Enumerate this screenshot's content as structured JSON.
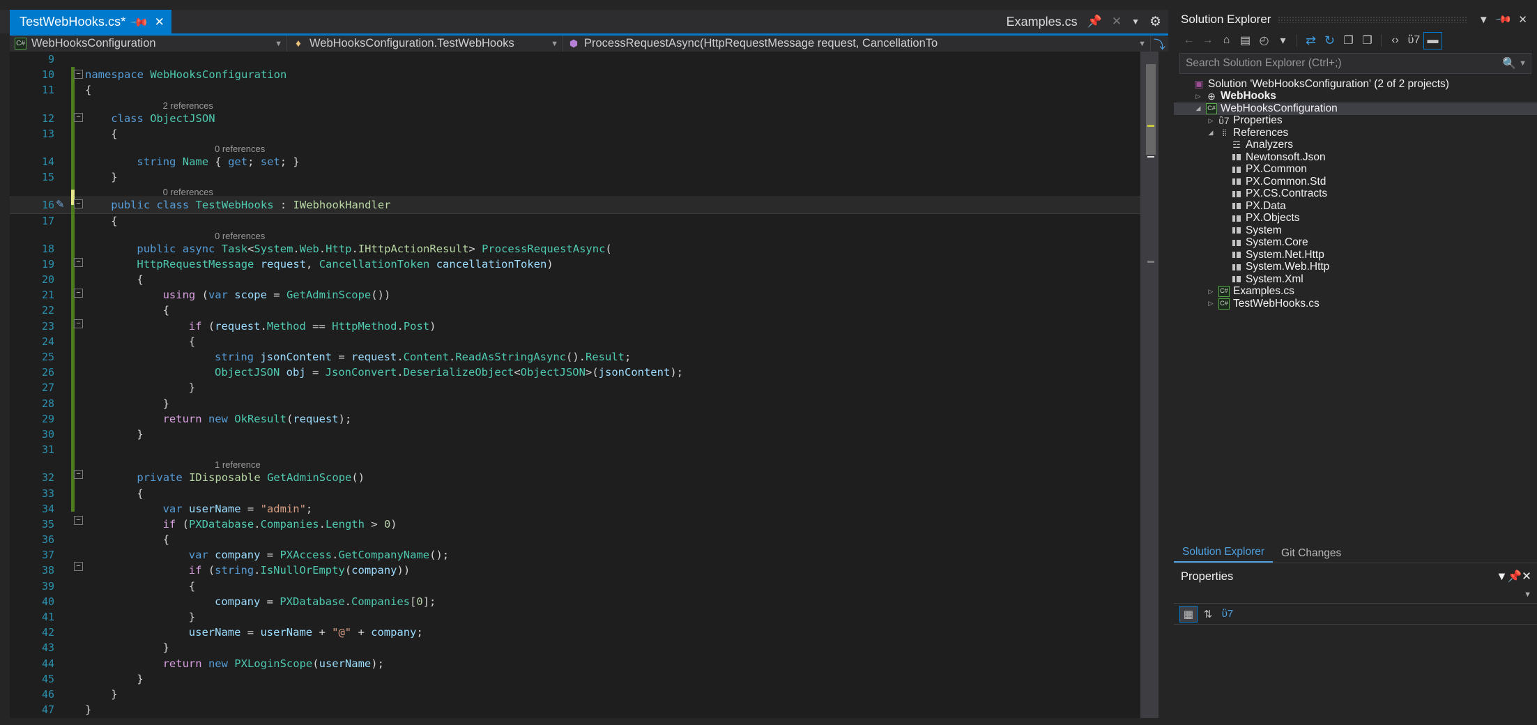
{
  "editor": {
    "tab": {
      "label": "TestWebHooks.cs*",
      "pin_icon": "pin-icon",
      "close_icon": "close-icon"
    },
    "tab_right": {
      "label": "Examples.cs",
      "pin_icon": "pin-icon",
      "close_icon": "close-icon",
      "caret_icon": "chevron-down-icon",
      "gear_icon": "gear-icon"
    },
    "navbar": {
      "project": "WebHooksConfiguration",
      "project_icon": "csharp-file-icon",
      "class": "WebHooksConfiguration.TestWebHooks",
      "class_icon": "class-icon",
      "member": "ProcessRequestAsync(HttpRequestMessage request, CancellationTo",
      "member_icon": "method-icon",
      "caret_icon": "chevron-down-icon",
      "split_icon": "split-view-icon"
    },
    "lines": [
      {
        "num": "9",
        "indent": 0,
        "text": ""
      },
      {
        "num": "10",
        "indent": 0,
        "text": "namespace WebHooksConfiguration"
      },
      {
        "num": "11",
        "indent": 0,
        "text": "{"
      },
      {
        "num": "",
        "ref": "2 references",
        "ref_indent": 3
      },
      {
        "num": "12",
        "indent": 1,
        "text": "class ObjectJSON"
      },
      {
        "num": "13",
        "indent": 1,
        "text": "{"
      },
      {
        "num": "",
        "ref": "0 references",
        "ref_indent": 5
      },
      {
        "num": "14",
        "indent": 2,
        "text": "string Name { get; set; }"
      },
      {
        "num": "15",
        "indent": 1,
        "text": "}"
      },
      {
        "num": "",
        "ref": "0 references",
        "ref_indent": 3
      },
      {
        "num": "16",
        "indent": 1,
        "text": "public class TestWebHooks : IWebhookHandler"
      },
      {
        "num": "17",
        "indent": 1,
        "text": "{"
      },
      {
        "num": "",
        "ref": "0 references",
        "ref_indent": 5
      },
      {
        "num": "18",
        "indent": 2,
        "text": "public async Task<System.Web.Http.IHttpActionResult> ProcessRequestAsync("
      },
      {
        "num": "19",
        "indent": 2,
        "text": "HttpRequestMessage request, CancellationToken cancellationToken)"
      },
      {
        "num": "20",
        "indent": 2,
        "text": "{"
      },
      {
        "num": "21",
        "indent": 3,
        "text": "using (var scope = GetAdminScope())"
      },
      {
        "num": "22",
        "indent": 3,
        "text": "{"
      },
      {
        "num": "23",
        "indent": 4,
        "text": "if (request.Method == HttpMethod.Post)"
      },
      {
        "num": "24",
        "indent": 4,
        "text": "{"
      },
      {
        "num": "25",
        "indent": 5,
        "text": "string jsonContent = request.Content.ReadAsStringAsync().Result;"
      },
      {
        "num": "26",
        "indent": 5,
        "text": "ObjectJSON obj = JsonConvert.DeserializeObject<ObjectJSON>(jsonContent);"
      },
      {
        "num": "27",
        "indent": 4,
        "text": "}"
      },
      {
        "num": "28",
        "indent": 3,
        "text": "}"
      },
      {
        "num": "29",
        "indent": 3,
        "text": "return new OkResult(request);"
      },
      {
        "num": "30",
        "indent": 2,
        "text": "}"
      },
      {
        "num": "31",
        "indent": 0,
        "text": ""
      },
      {
        "num": "",
        "ref": "1 reference",
        "ref_indent": 5
      },
      {
        "num": "32",
        "indent": 2,
        "text": "private IDisposable GetAdminScope()"
      },
      {
        "num": "33",
        "indent": 2,
        "text": "{"
      },
      {
        "num": "34",
        "indent": 3,
        "text": "var userName = \"admin\";"
      },
      {
        "num": "35",
        "indent": 3,
        "text": "if (PXDatabase.Companies.Length > 0)"
      },
      {
        "num": "36",
        "indent": 3,
        "text": "{"
      },
      {
        "num": "37",
        "indent": 4,
        "text": "var company = PXAccess.GetCompanyName();"
      },
      {
        "num": "38",
        "indent": 4,
        "text": "if (string.IsNullOrEmpty(company))"
      },
      {
        "num": "39",
        "indent": 4,
        "text": "{"
      },
      {
        "num": "40",
        "indent": 5,
        "text": "company = PXDatabase.Companies[0];"
      },
      {
        "num": "41",
        "indent": 4,
        "text": "}"
      },
      {
        "num": "42",
        "indent": 4,
        "text": "userName = userName + \"@\" + company;"
      },
      {
        "num": "43",
        "indent": 3,
        "text": "}"
      },
      {
        "num": "44",
        "indent": 3,
        "text": "return new PXLoginScope(userName);"
      },
      {
        "num": "45",
        "indent": 2,
        "text": "}"
      },
      {
        "num": "46",
        "indent": 1,
        "text": "}"
      },
      {
        "num": "47",
        "indent": 0,
        "text": "}"
      }
    ]
  },
  "solution_explorer": {
    "title": "Solution Explorer",
    "header_icons": {
      "dropdown": "chevron-down-icon",
      "pin": "pin-icon",
      "close": "close-icon"
    },
    "toolbar": [
      {
        "name": "back-icon",
        "glyph": "←",
        "state": "disabled"
      },
      {
        "name": "forward-icon",
        "glyph": "→",
        "state": "disabled"
      },
      {
        "name": "home-icon",
        "glyph": "⌂",
        "state": "normal"
      },
      {
        "name": "sync-with-active-document-icon",
        "glyph": "▤",
        "state": "normal"
      },
      {
        "name": "pending-changes-filter-icon",
        "glyph": "◴",
        "state": "normal"
      },
      {
        "name": "filter-caret-icon",
        "glyph": "▾",
        "state": "normal"
      },
      {
        "name": "refresh-icon",
        "glyph": "⇄",
        "state": "blue"
      },
      {
        "name": "reload-icon",
        "glyph": "↻",
        "state": "blue"
      },
      {
        "name": "collapse-all-icon",
        "glyph": "❐",
        "state": "normal"
      },
      {
        "name": "copy-icon",
        "glyph": "❐",
        "state": "normal"
      },
      {
        "name": "show-all-files-icon",
        "glyph": "‹›",
        "state": "normal"
      },
      {
        "name": "properties-wrench-icon",
        "glyph": "ὒ7",
        "state": "normal"
      },
      {
        "name": "preview-selected-items-icon",
        "glyph": "▬",
        "state": "boxed"
      }
    ],
    "search_placeholder": "Search Solution Explorer (Ctrl+;)",
    "search_value": "",
    "search_icon": "search-icon",
    "search_caret_icon": "chevron-down-icon",
    "tree": [
      {
        "label": "Solution 'WebHooksConfiguration' (2 of 2 projects)",
        "depth": 0,
        "twisty": "",
        "icon": "solution-icon",
        "bold": false,
        "selected": false
      },
      {
        "label": "WebHooks",
        "depth": 1,
        "twisty": "collapsed",
        "icon": "web-project-icon",
        "bold": true,
        "selected": false
      },
      {
        "label": "WebHooksConfiguration",
        "depth": 1,
        "twisty": "expanded",
        "icon": "csharp-project-icon",
        "bold": false,
        "selected": true
      },
      {
        "label": "Properties",
        "depth": 2,
        "twisty": "collapsed",
        "icon": "properties-icon",
        "bold": false,
        "selected": false
      },
      {
        "label": "References",
        "depth": 2,
        "twisty": "expanded",
        "icon": "references-icon",
        "bold": false,
        "selected": false
      },
      {
        "label": "Analyzers",
        "depth": 3,
        "twisty": "",
        "icon": "analyzers-icon",
        "bold": false,
        "selected": false
      },
      {
        "label": "Newtonsoft.Json",
        "depth": 3,
        "twisty": "",
        "icon": "assembly-icon",
        "bold": false,
        "selected": false
      },
      {
        "label": "PX.Common",
        "depth": 3,
        "twisty": "",
        "icon": "assembly-icon",
        "bold": false,
        "selected": false
      },
      {
        "label": "PX.Common.Std",
        "depth": 3,
        "twisty": "",
        "icon": "assembly-icon",
        "bold": false,
        "selected": false
      },
      {
        "label": "PX.CS.Contracts",
        "depth": 3,
        "twisty": "",
        "icon": "assembly-icon",
        "bold": false,
        "selected": false
      },
      {
        "label": "PX.Data",
        "depth": 3,
        "twisty": "",
        "icon": "assembly-icon",
        "bold": false,
        "selected": false
      },
      {
        "label": "PX.Objects",
        "depth": 3,
        "twisty": "",
        "icon": "assembly-icon",
        "bold": false,
        "selected": false
      },
      {
        "label": "System",
        "depth": 3,
        "twisty": "",
        "icon": "assembly-icon",
        "bold": false,
        "selected": false
      },
      {
        "label": "System.Core",
        "depth": 3,
        "twisty": "",
        "icon": "assembly-icon",
        "bold": false,
        "selected": false
      },
      {
        "label": "System.Net.Http",
        "depth": 3,
        "twisty": "",
        "icon": "assembly-icon",
        "bold": false,
        "selected": false
      },
      {
        "label": "System.Web.Http",
        "depth": 3,
        "twisty": "",
        "icon": "assembly-icon",
        "bold": false,
        "selected": false
      },
      {
        "label": "System.Xml",
        "depth": 3,
        "twisty": "",
        "icon": "assembly-icon",
        "bold": false,
        "selected": false
      },
      {
        "label": "Examples.cs",
        "depth": 2,
        "twisty": "collapsed",
        "icon": "csharp-file-icon",
        "bold": false,
        "selected": false
      },
      {
        "label": "TestWebHooks.cs",
        "depth": 2,
        "twisty": "collapsed",
        "icon": "csharp-file-icon",
        "bold": false,
        "selected": false
      }
    ],
    "bottom_tabs": [
      {
        "label": "Solution Explorer",
        "active": true
      },
      {
        "label": "Git Changes",
        "active": false
      }
    ]
  },
  "properties": {
    "title": "Properties",
    "header_icons": {
      "dropdown": "chevron-down-icon",
      "pin": "pin-icon",
      "close": "close-icon"
    },
    "sub_caret_icon": "chevron-down-icon",
    "toolbar": [
      {
        "name": "categorized-icon",
        "glyph": "▦",
        "state": "selected"
      },
      {
        "name": "alphabetical-icon",
        "glyph": "⇅",
        "state": "normal"
      },
      {
        "name": "property-pages-icon",
        "glyph": "ὒ7",
        "state": "blue"
      }
    ]
  },
  "colors": {
    "accent": "#007acc",
    "tab_active_bg": "#007acc",
    "editor_bg": "#1e1e1e",
    "chrome_bg": "#252526",
    "panel_selection": "#3f3f46",
    "line_number": "#2b91af",
    "keyword": "#569cd6",
    "control_keyword": "#d8a0df",
    "type": "#4ec9b0",
    "string": "#d69d85",
    "method": "#dcdcaa",
    "variable": "#9cdcfe",
    "interface": "#b8d7a3",
    "change_bar_saved": "#4d7d1f",
    "change_bar_unsaved": "#e6e68a"
  }
}
